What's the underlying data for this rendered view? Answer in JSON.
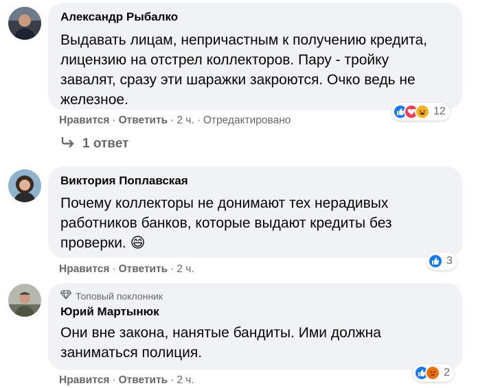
{
  "comments": [
    {
      "author": "Александр Рыбалко",
      "text": "Выдавать лицам, непричастным к получению кредита,\nлицензию на отстрел коллекторов. Пару - тройку\nзавалят, сразу эти шаражки закроются. Очко ведь не\nжелезное.",
      "like_label": "Нравится",
      "reply_label": "Ответить",
      "time": "2 ч.",
      "edited": "Отредактировано",
      "reactions": [
        "like",
        "love",
        "haha"
      ],
      "reaction_count": "12",
      "replies_label": "1 ответ"
    },
    {
      "author": "Виктория Поплавская",
      "text": "Почему коллекторы не донимают тех нерадивых\nработников банков, которые выдают кредиты без\nпроверки.",
      "emoji": "😄",
      "like_label": "Нравится",
      "reply_label": "Ответить",
      "time": "2 ч.",
      "reactions": [
        "like"
      ],
      "reaction_count": "3"
    },
    {
      "badge": "Топовый поклонник",
      "author": "Юрий Мартынюк",
      "text": "Они вне закона, нанятые бандиты. Ими должна\nзаниматься полиция.",
      "like_label": "Нравится",
      "reply_label": "Ответить",
      "time": "2 ч.",
      "reactions": [
        "like",
        "angry"
      ],
      "reaction_count": "2"
    }
  ],
  "colors": {
    "bubble": "#f0f2f5",
    "meta": "#65676b",
    "like": "#1877f2",
    "love": "#f33e58",
    "haha": "#f7b125",
    "angry": "#e9710f"
  }
}
